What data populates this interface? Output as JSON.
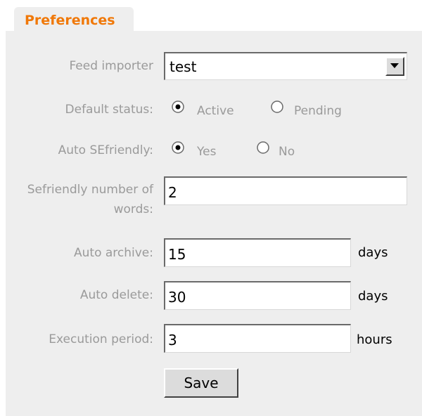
{
  "tab": {
    "label": "Preferences"
  },
  "form": {
    "feed_importer": {
      "label": "Feed importer",
      "value": "test"
    },
    "default_status": {
      "label": "Default status:",
      "options": [
        {
          "label": "Active",
          "checked": true
        },
        {
          "label": "Pending",
          "checked": false
        }
      ]
    },
    "auto_sefriendly": {
      "label": "Auto SEfriendly:",
      "options": [
        {
          "label": "Yes",
          "checked": true
        },
        {
          "label": "No",
          "checked": false
        }
      ]
    },
    "sefriendly_words": {
      "label": "Sefriendly number of words:",
      "value": "2"
    },
    "auto_archive": {
      "label": "Auto archive:",
      "value": "15",
      "unit": "days"
    },
    "auto_delete": {
      "label": "Auto delete:",
      "value": "30",
      "unit": "days"
    },
    "execution_period": {
      "label": "Execution period:",
      "value": "3",
      "unit": "hours"
    },
    "save_label": "Save"
  },
  "colors": {
    "tab_text": "#f07808",
    "panel_bg": "#eeeeee",
    "label_text": "#9a9a9a"
  }
}
